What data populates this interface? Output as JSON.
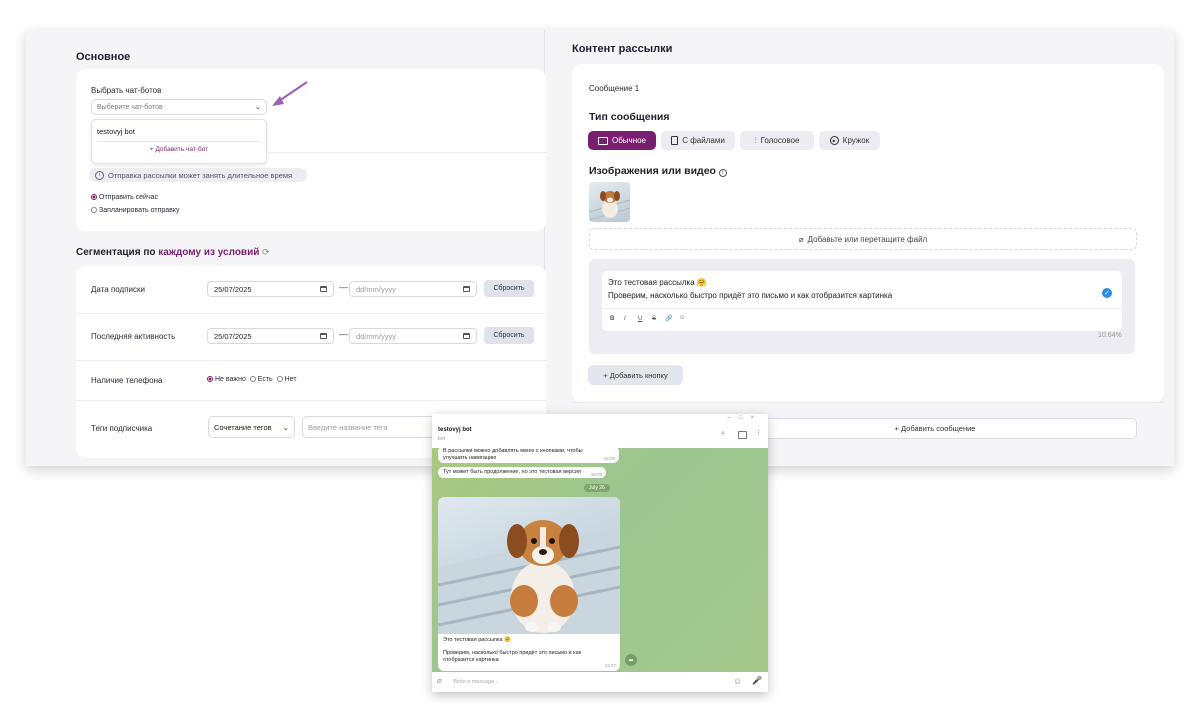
{
  "left": {
    "section_basic": "Основное",
    "chatbots_label": "Выбрать чат-ботов",
    "chatbots_placeholder": "Выберите чат-ботов",
    "dropdown_item": "testovyj bot",
    "dropdown_add": "+ Добавить чат-бот",
    "note": "Отправка рассылки может занять длительное время",
    "send_now": "Отправить сейчас",
    "schedule": "Запланировать отправку",
    "seg_prefix": "Сегментация по",
    "seg_link": "каждому из условий",
    "rows": {
      "sub_date": "Дата подписки",
      "last_activity": "Последняя активность",
      "phone": "Наличие телефона",
      "tags": "Теги подписчика"
    },
    "date_value": "25/07/2025",
    "date_placeholder": "dd/mm/yyyy",
    "reset": "Сбросить",
    "phone_options": [
      "Не важно",
      "Есть",
      "Нет"
    ],
    "tags_combo": "Сочетание тегов",
    "tags_placeholder": "Введите название тега"
  },
  "right": {
    "title": "Контент рассылки",
    "message_label": "Сообщение 1",
    "type_title": "Тип сообщения",
    "types": [
      "Обычное",
      "С файлами",
      "Голосовое",
      "Кружок"
    ],
    "media_title": "Изображения или видео",
    "add_file": "Добавьте или перетащите файл",
    "text_line1": "Это тестовая рассылка 🤗",
    "text_line2": "Проверим, насколько быстро придёт это письмо и как отобразится картинка",
    "fmt": [
      "B",
      "I",
      "U",
      "S",
      "🔗",
      "☺"
    ],
    "percent": "10.64%",
    "add_button": "+ Добавить кнопку",
    "add_message": "+ Добавить сообщение"
  },
  "telegram": {
    "chat_name": "testovyj bot",
    "chat_status": "bot",
    "msg1": "В рассылки можно добавлять меню с кнопками, чтобы улучшить навигацию",
    "msg1_time": "16:09",
    "msg2": "Тут может быть продолжение, но это тестовая версия",
    "msg2_time": "16:09",
    "date_chip": "July 26",
    "caption1": "Это тестовая рассылка 🤗",
    "caption2": "Проверим, насколько быстро придёт это письмо и как отобразится картинка",
    "caption_time": "12:27",
    "input_placeholder": "Write a message..."
  }
}
